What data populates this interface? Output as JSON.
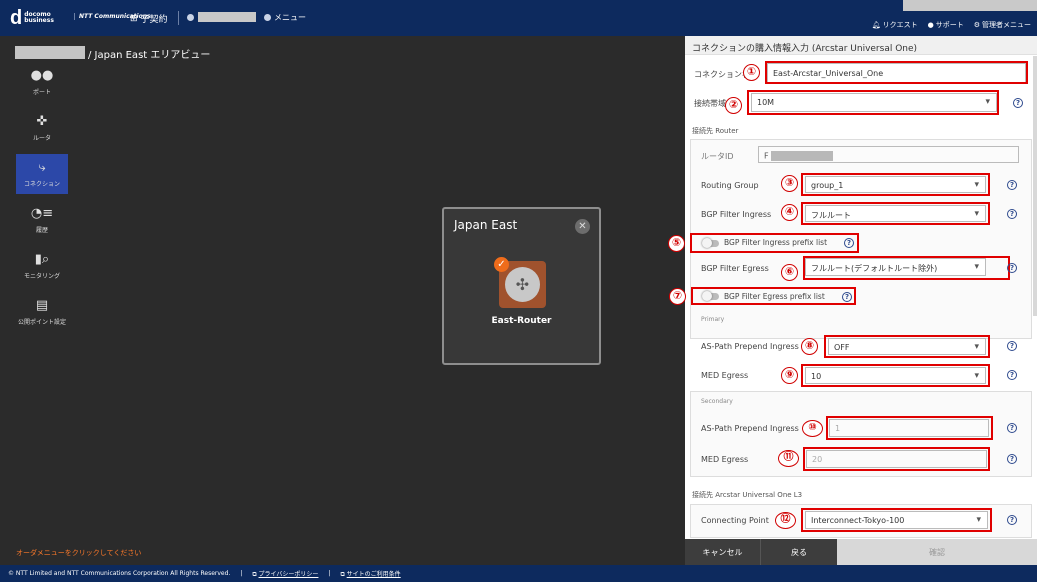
{
  "header": {
    "logo_mark": "d",
    "logo_text": "docomo business",
    "ntt_text": "NTT Communications",
    "sub_contract": "子契約",
    "menu_label": "メニュー",
    "links": [
      "リクエスト",
      "サポート",
      "管理者メニュー"
    ]
  },
  "breadcrumb": {
    "area": "/ Japan East エリアビュー"
  },
  "sidebar": {
    "items": [
      {
        "label": "ポート",
        "icon": "port-icon"
      },
      {
        "label": "ルータ",
        "icon": "router-icon"
      },
      {
        "label": "コネクション",
        "icon": "connection-icon",
        "active": true
      },
      {
        "label": "履歴",
        "icon": "history-icon"
      },
      {
        "label": "モニタリング",
        "icon": "monitoring-icon"
      },
      {
        "label": "公開ポイント設定",
        "icon": "public-point-icon"
      }
    ]
  },
  "order_hint": "オーダメニューをクリックしてください",
  "canvas_card": {
    "title": "Japan East",
    "router_name": "East-Router"
  },
  "footer": {
    "copyright": "© NTT Limited and NTT Communications Corporation All Rights Reserved.",
    "privacy": "プライバシーポリシー",
    "terms": "サイトのご利用条件"
  },
  "panel": {
    "title": "コネクションの購入情報入力 (Arcstar Universal One)",
    "connection_name_label": "コネクション名",
    "connection_name_value": "East-Arcstar_Universal_One",
    "bandwidth_label": "接続帯域",
    "bandwidth_value": "10M",
    "router_section": "接続先 Router",
    "router_id_label": "ルータID",
    "router_id_value": "F",
    "routing_group_label": "Routing Group",
    "routing_group_value": "group_1",
    "bgp_in_label": "BGP Filter Ingress",
    "bgp_in_value": "フルルート",
    "bgp_in_prefix_label": "BGP Filter Ingress prefix list",
    "bgp_eg_label": "BGP Filter Egress",
    "bgp_eg_value": "フルルート(デフォルトルート除外)",
    "bgp_eg_prefix_label": "BGP Filter Egress prefix list",
    "primary_label": "Primary",
    "as_path_label": "AS-Path Prepend Ingress",
    "as_path_value": "OFF",
    "med_label": "MED Egress",
    "med_value": "10",
    "secondary_label": "Secondary",
    "as_path2_label": "AS-Path Prepend Ingress",
    "as_path2_value": "1",
    "med2_label": "MED Egress",
    "med2_value": "20",
    "l3_section": "接続先 Arcstar Universal One L3",
    "connecting_point_label": "Connecting Point",
    "connecting_point_value": "Interconnect-Tokyo-100",
    "cancel": "キャンセル",
    "back": "戻る",
    "confirm": "確認"
  },
  "markers": [
    "①",
    "②",
    "③",
    "④",
    "⑤",
    "⑥",
    "⑦",
    "⑧",
    "⑨",
    "⑩",
    "⑪",
    "⑫"
  ],
  "colors": {
    "header_bg": "#0d2a5e",
    "active_nav": "#2c48a8",
    "highlight": "#e00000",
    "router": "#a0522d"
  }
}
